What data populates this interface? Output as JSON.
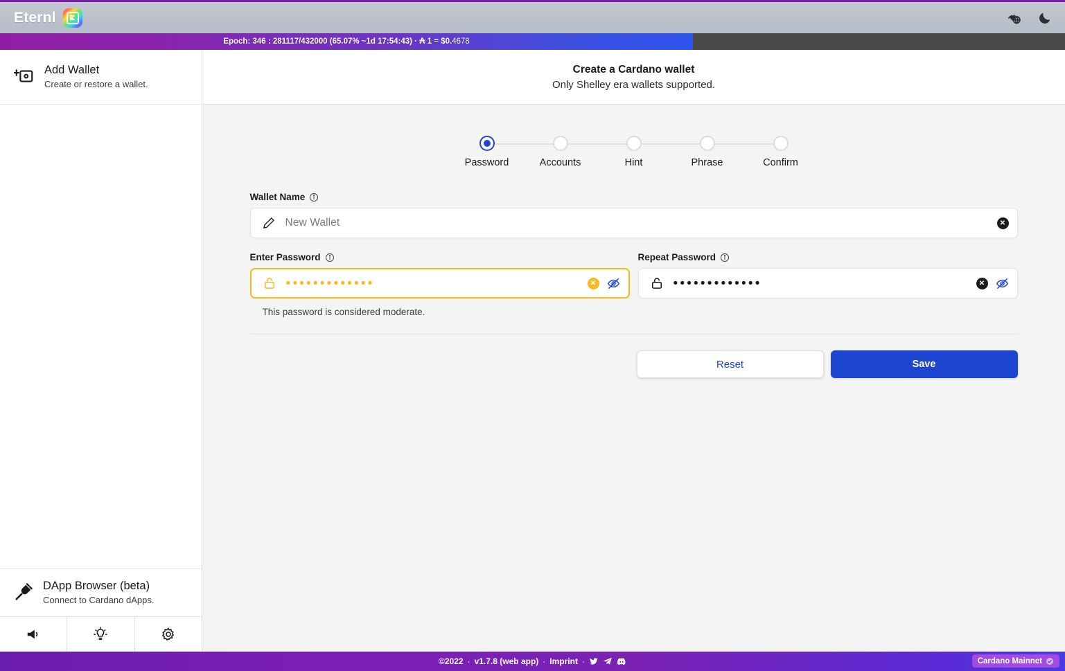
{
  "titlebar": {
    "brand_name": "Eternl",
    "logo_icon": "eternl-logo-icon",
    "dapp_connector_icon": "dapp-globe-icon",
    "theme_toggle_icon": "moon-icon"
  },
  "epoch_bar": {
    "prefix": "Epoch: 346 : 281117/432000 (65.07% ~1d 17:54:43) · ",
    "ada_symbol": "₳",
    "ada_rate": " 1 = $0.",
    "rate_decimals": "4678",
    "full_text": "Epoch: 346 : 281117/432000 (65.07% ~1d 17:54:43) · ₳ 1 = $0.4678",
    "progress_percent": 65.07,
    "fill_color_start": "#8e1fa5",
    "fill_color_end": "#2f55ef",
    "track_color": "#4a4a4a"
  },
  "sidebar": {
    "add_wallet": {
      "icon": "add-wallet-icon",
      "title": "Add Wallet",
      "subtitle": "Create or restore a wallet."
    },
    "dapp_browser": {
      "icon": "plug-icon",
      "title": "DApp Browser (beta)",
      "subtitle": "Connect to Cardano dApps."
    },
    "tools": [
      {
        "icon": "megaphone-icon",
        "name": "announcements-button"
      },
      {
        "icon": "lightbulb-icon",
        "name": "tips-button"
      },
      {
        "icon": "gear-icon",
        "name": "settings-button"
      }
    ]
  },
  "main": {
    "header": {
      "title": "Create a Cardano wallet",
      "subtitle": "Only Shelley era wallets supported."
    },
    "stepper": {
      "active_index": 0,
      "active_color": "#1d46d0",
      "steps": [
        {
          "label": "Password"
        },
        {
          "label": "Accounts"
        },
        {
          "label": "Hint"
        },
        {
          "label": "Phrase"
        },
        {
          "label": "Confirm"
        }
      ]
    },
    "form": {
      "wallet_name": {
        "label": "Wallet Name",
        "info_icon": "info-icon",
        "lead_icon": "pencil-icon",
        "value": "New Wallet",
        "placeholder": "New Wallet",
        "clear_icon": "clear-circle-icon"
      },
      "enter_password": {
        "label": "Enter Password",
        "info_icon": "info-icon",
        "lead_icon": "lock-icon",
        "masked_value": "•••••••••••••",
        "char_count": 13,
        "clear_icon": "clear-circle-icon",
        "reveal_icon": "eye-off-icon",
        "state": "warning",
        "border_color": "#f5b921",
        "helper_text": "This password is considered moderate."
      },
      "repeat_password": {
        "label": "Repeat Password",
        "info_icon": "info-icon",
        "lead_icon": "lock-icon",
        "masked_value": "•••••••••••••",
        "char_count": 13,
        "clear_icon": "clear-circle-icon",
        "reveal_icon": "eye-off-icon",
        "state": "normal"
      },
      "buttons": {
        "reset_label": "Reset",
        "save_label": "Save",
        "save_color": "#1d46d0"
      }
    }
  },
  "footer": {
    "copyright": "©2022",
    "sep1": "·",
    "version": "v1.7.8 (web app)",
    "sep2": "·",
    "imprint": "Imprint",
    "sep3": "·",
    "social": [
      {
        "icon": "twitter-icon"
      },
      {
        "icon": "telegram-icon"
      },
      {
        "icon": "discord-icon"
      }
    ],
    "network": {
      "label": "Cardano Mainnet",
      "status_icon": "check-badge-icon",
      "pill_color": "#a14be0"
    }
  }
}
